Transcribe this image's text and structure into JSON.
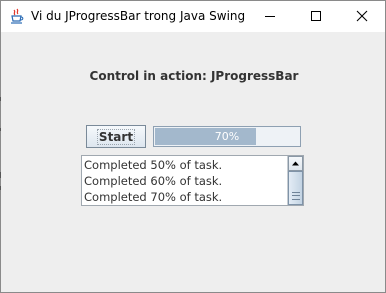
{
  "window": {
    "title": "Vi du JProgressBar trong Java Swing",
    "icon": "java-cup-icon"
  },
  "titlebar_buttons": {
    "minimize_icon": "minimize-icon",
    "maximize_icon": "maximize-icon",
    "close_icon": "close-icon"
  },
  "content": {
    "heading": "Control in action: JProgressBar",
    "start_label": "Start",
    "progress": {
      "value": 70,
      "label": "70%"
    },
    "log_lines": [
      "Completed 50% of task.",
      "Completed 60% of task.",
      "Completed 70% of task."
    ]
  },
  "colors": {
    "progress_fill": "#a3b8cc",
    "window_bg": "#eeeeee"
  }
}
